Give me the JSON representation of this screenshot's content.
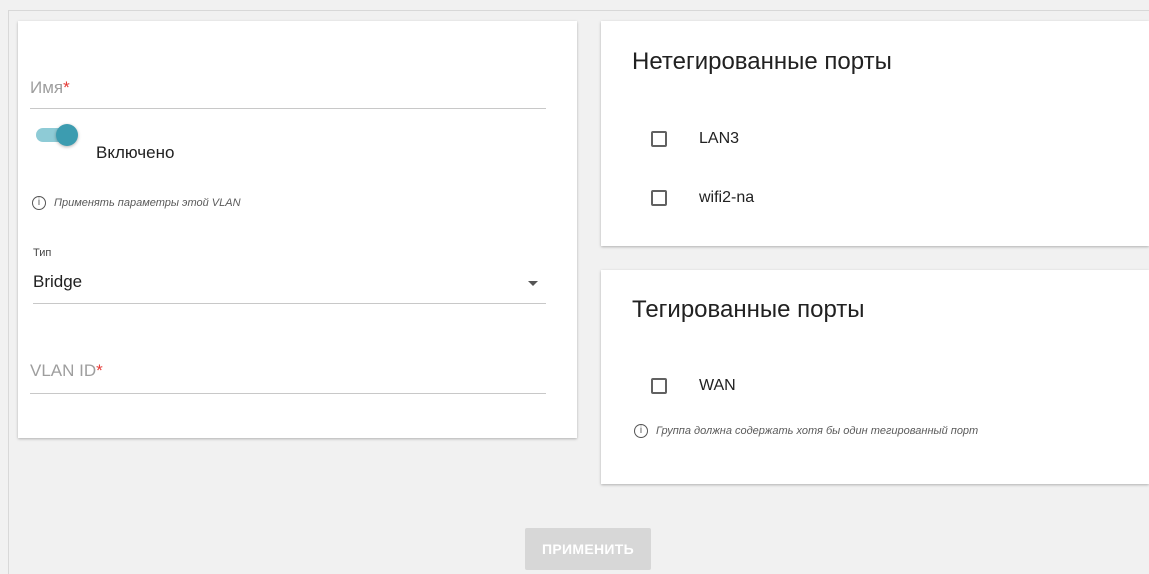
{
  "settings": {
    "name_placeholder": "Имя",
    "required_mark": "*",
    "enabled": true,
    "enabled_label": "Включено",
    "enabled_hint": "Применять параметры этой VLAN",
    "type_label": "Тип",
    "type_value": "Bridge",
    "vlan_id_placeholder": "VLAN ID"
  },
  "untagged": {
    "title": "Нетегированные порты",
    "ports": [
      {
        "label": "LAN3",
        "checked": false
      },
      {
        "label": "wifi2-na",
        "checked": false
      }
    ]
  },
  "tagged": {
    "title": "Тегированные порты",
    "ports": [
      {
        "label": "WAN",
        "checked": false
      }
    ],
    "hint": "Группа должна содержать хотя бы один тегированный порт"
  },
  "apply_button": {
    "label": "ПРИМЕНИТЬ",
    "disabled": true
  },
  "icons": {
    "info": "info-icon",
    "dropdown": "dropdown-caret-icon",
    "checkbox": "checkbox-icon"
  },
  "colors": {
    "accent": "#3c9cb0",
    "accent_track": "#8ecbd6",
    "required": "#e53935",
    "disabled_button": "#d7d7d7"
  }
}
